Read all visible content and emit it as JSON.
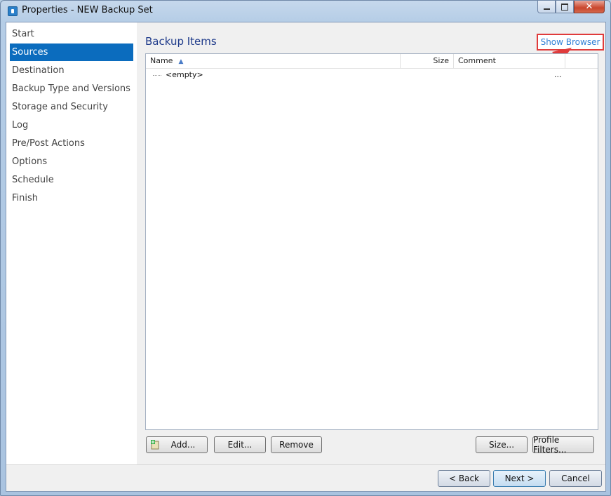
{
  "window": {
    "title": "Properties - NEW Backup Set"
  },
  "sidebar": {
    "items": [
      {
        "label": "Start"
      },
      {
        "label": "Sources"
      },
      {
        "label": "Destination"
      },
      {
        "label": "Backup Type and Versions"
      },
      {
        "label": "Storage and Security"
      },
      {
        "label": "Log"
      },
      {
        "label": "Pre/Post Actions"
      },
      {
        "label": "Options"
      },
      {
        "label": "Schedule"
      },
      {
        "label": "Finish"
      }
    ],
    "selected": "Sources"
  },
  "main": {
    "title": "Backup Items",
    "show_browser": "Show Browser",
    "list": {
      "columns": {
        "name": "Name",
        "size": "Size",
        "comment": "Comment"
      },
      "rows": [
        {
          "name": "<empty>",
          "extra": "..."
        }
      ]
    },
    "buttons": {
      "add": "Add...",
      "edit": "Edit...",
      "remove": "Remove",
      "size": "Size...",
      "profile_filters": "Profile Filters..."
    }
  },
  "footer": {
    "back": "< Back",
    "next": "Next >",
    "cancel": "Cancel"
  },
  "colors": {
    "selection": "#0b6cbe",
    "link": "#2f7fd6",
    "highlight": "#e03b3b",
    "title_blue": "#1e3a8a"
  }
}
